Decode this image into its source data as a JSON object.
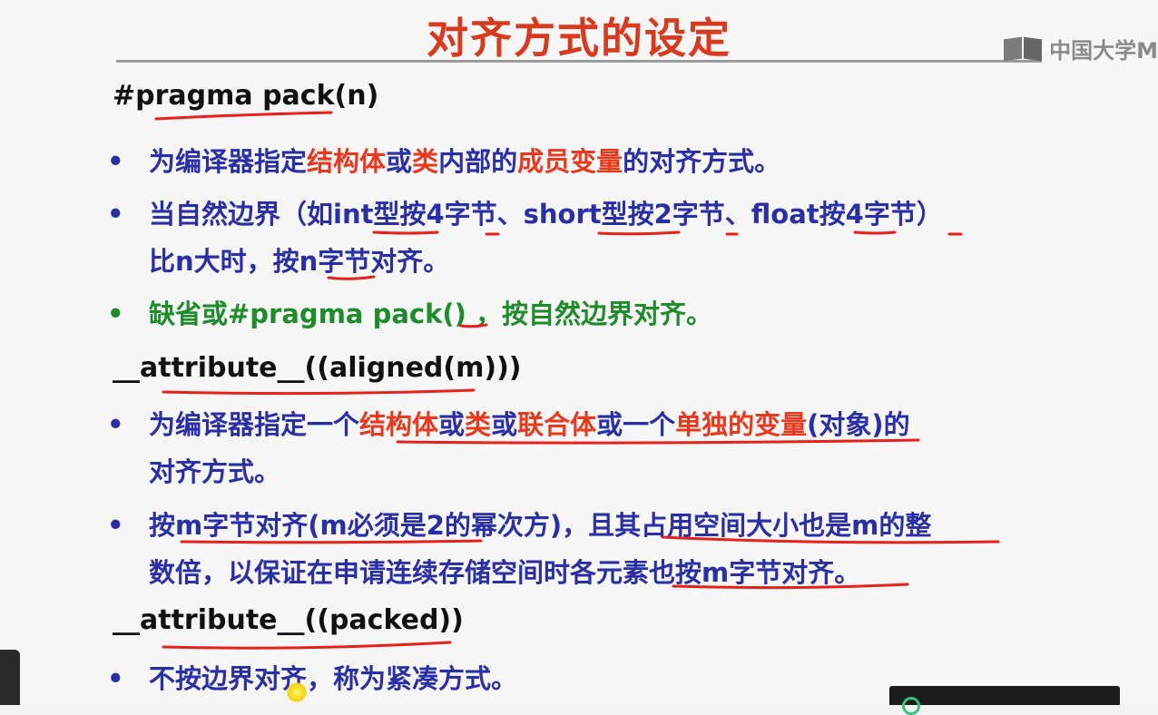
{
  "slide": {
    "title": "对齐方式的设定",
    "watermark": "中国大学M"
  },
  "sections": [
    {
      "heading": "#pragma pack(n)",
      "bullets": [
        {
          "segments": [
            {
              "t": "为编译器指定",
              "c": "blue"
            },
            {
              "t": "结构体",
              "c": "red"
            },
            {
              "t": "或",
              "c": "blue"
            },
            {
              "t": "类",
              "c": "red"
            },
            {
              "t": "内部的",
              "c": "blue"
            },
            {
              "t": "成员变量",
              "c": "red"
            },
            {
              "t": "的对齐方式。",
              "c": "blue"
            }
          ]
        },
        {
          "segments": [
            {
              "t": "当自然边界（如int型按4字节、short型按2字节、float按4字节）",
              "c": "blue"
            },
            {
              "t": "\n",
              "c": "blue"
            },
            {
              "t": "比n大时，按n字节对齐。",
              "c": "blue"
            }
          ]
        },
        {
          "segments": [
            {
              "t": "缺省或#pragma pack() ，按自然边界对齐。",
              "c": "green"
            }
          ]
        }
      ]
    },
    {
      "heading": "__attribute__((aligned(m)))",
      "bullets": [
        {
          "segments": [
            {
              "t": "为编译器指定一个",
              "c": "blue"
            },
            {
              "t": "结构体",
              "c": "red"
            },
            {
              "t": "或",
              "c": "blue"
            },
            {
              "t": "类",
              "c": "red"
            },
            {
              "t": "或",
              "c": "blue"
            },
            {
              "t": "联合体",
              "c": "red"
            },
            {
              "t": "或一个",
              "c": "blue"
            },
            {
              "t": "单独的变量",
              "c": "red"
            },
            {
              "t": "(对象)的",
              "c": "blue"
            },
            {
              "t": "\n",
              "c": "blue"
            },
            {
              "t": "对齐方式。",
              "c": "blue"
            }
          ]
        },
        {
          "segments": [
            {
              "t": "按m字节对齐(m必须是2的幂次方)，且其占用空间大小也是m的整",
              "c": "blue"
            },
            {
              "t": "\n",
              "c": "blue"
            },
            {
              "t": "数倍，以保证在申请连续存储空间时各元素也按m字节对齐。",
              "c": "blue"
            }
          ]
        }
      ]
    },
    {
      "heading": "__attribute__((packed))",
      "bullets": [
        {
          "segments": [
            {
              "t": "不按边界对齐，称为紧凑方式。",
              "c": "blue"
            }
          ]
        }
      ]
    }
  ],
  "bullet_symbol": "•",
  "colors": {
    "title": "#d83a1f",
    "blue": "#2b2fa6",
    "red": "#e8391f",
    "green": "#1e8c2a",
    "ink": "#e8201a"
  }
}
